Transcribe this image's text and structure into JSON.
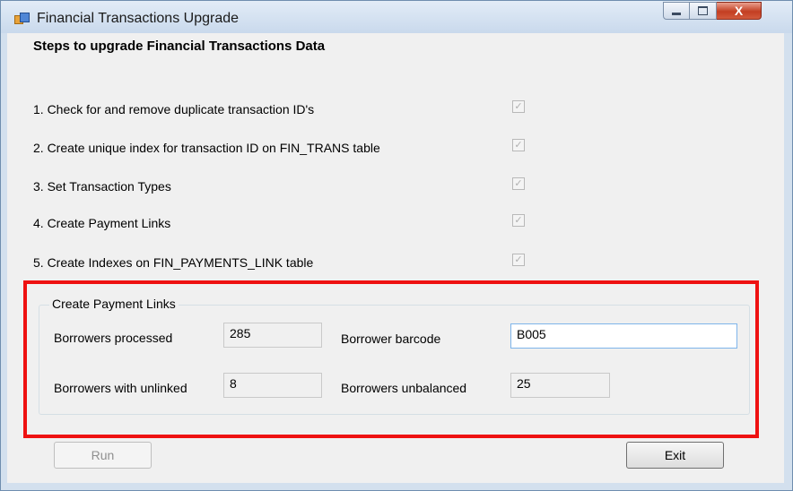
{
  "window": {
    "title": "Financial Transactions Upgrade",
    "app_icon": "app-window-icon",
    "close_glyph": "X"
  },
  "heading": "Steps to upgrade Financial Transactions Data",
  "steps": [
    {
      "label": "1. Check for and remove duplicate transaction ID's",
      "checked": true
    },
    {
      "label": "2. Create unique index for transaction ID on FIN_TRANS table",
      "checked": true
    },
    {
      "label": "3. Set Transaction Types",
      "checked": true
    },
    {
      "label": "4. Create Payment Links",
      "checked": true
    },
    {
      "label": "5. Create Indexes on FIN_PAYMENTS_LINK table",
      "checked": true
    }
  ],
  "check_glyph": "✓",
  "group": {
    "title": "Create Payment Links",
    "borrowers_processed_label": "Borrowers processed",
    "borrowers_processed": "285",
    "borrower_barcode_label": "Borrower barcode",
    "borrower_barcode": "B005",
    "borrowers_unlinked_label": "Borrowers with unlinked",
    "borrowers_unlinked": "8",
    "borrowers_unbalanced_label": "Borrowers unbalanced",
    "borrowers_unbalanced": "25"
  },
  "buttons": {
    "run": "Run",
    "exit": "Exit"
  },
  "colors": {
    "highlight": "#ee1111",
    "close_button": "#c33e22",
    "field_focus_border": "#7eb4ea"
  }
}
